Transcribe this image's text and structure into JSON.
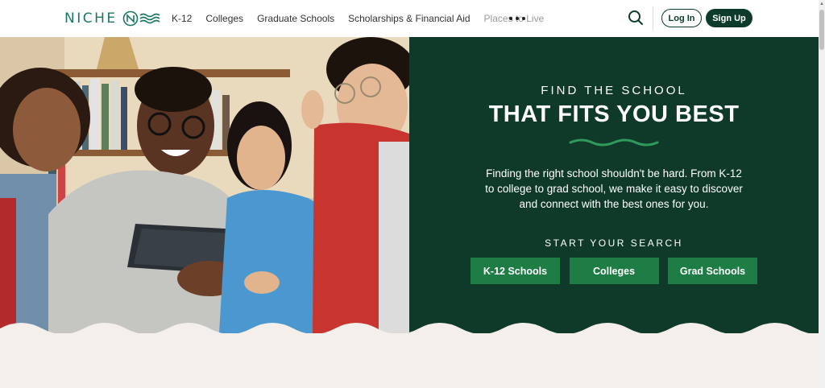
{
  "header": {
    "logo_text": "NICHE",
    "nav": [
      "K-12",
      "Colleges",
      "Graduate Schools",
      "Scholarships & Financial Aid",
      "Places to Live"
    ],
    "more_icon": "ellipsis-icon",
    "search_icon": "search-icon",
    "login_label": "Log In",
    "signup_label": "Sign Up"
  },
  "hero": {
    "eyebrow": "FIND THE SCHOOL",
    "headline": "THAT FITS YOU BEST",
    "description": "Finding the right school shouldn't be hard. From K-12 to college to grad school, we make it easy to discover and connect with the best ones for you.",
    "start_label": "START YOUR SEARCH",
    "buttons": [
      "K-12 Schools",
      "Colleges",
      "Grad Schools"
    ]
  },
  "colors": {
    "brand_dark": "#0f3a2a",
    "brand_green": "#1e7d45",
    "logo_teal": "#1a7864",
    "page_bg": "#f4efeb"
  }
}
